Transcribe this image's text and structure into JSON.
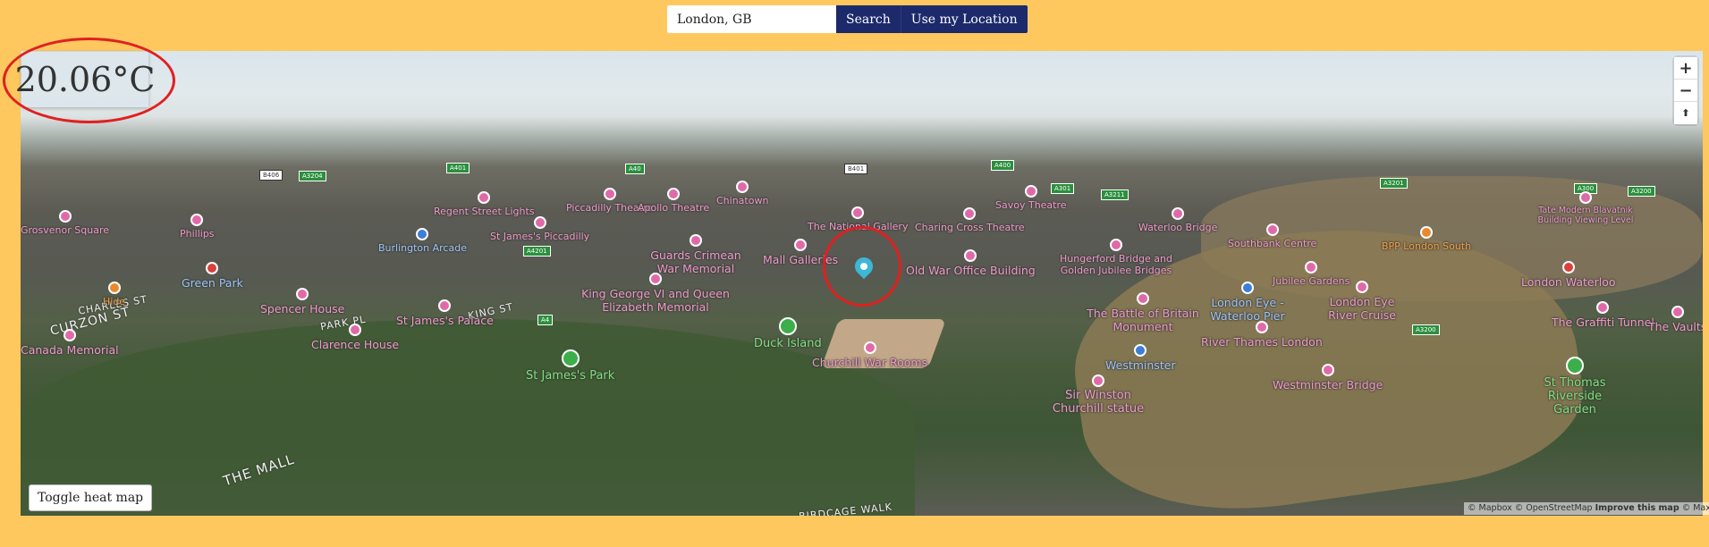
{
  "search": {
    "placeholder": "London, GB",
    "value": "London, GB",
    "search_label": "Search",
    "location_label": "Use my Location"
  },
  "weather": {
    "temperature": "20.06°C"
  },
  "map": {
    "zoom_in": "+",
    "zoom_out": "−",
    "compass": "⬆",
    "toggle_heat_label": "Toggle heat map",
    "attribution": {
      "mapbox": "© Mapbox",
      "osm": "© OpenStreetMap",
      "improve": "Improve this map",
      "maxar": "© Maxar"
    },
    "pois": [
      {
        "label": "Charing Cross Theatre",
        "kind": "pink"
      },
      {
        "label": "Old War Office Building",
        "kind": "pink"
      },
      {
        "label": "Mall Galleries",
        "kind": "pink"
      },
      {
        "label": "Guards Crimean War Memorial",
        "kind": "pink"
      },
      {
        "label": "King George VI and Queen Elizabeth Memorial",
        "kind": "pink"
      },
      {
        "label": "St James's Palace",
        "kind": "pink"
      },
      {
        "label": "Spencer House",
        "kind": "pink"
      },
      {
        "label": "Clarence House",
        "kind": "pink"
      },
      {
        "label": "Duck Island",
        "kind": "green"
      },
      {
        "label": "St James's Park",
        "kind": "green"
      },
      {
        "label": "Churchill War Rooms",
        "kind": "pink"
      },
      {
        "label": "Sir Winston Churchill statue",
        "kind": "pink"
      },
      {
        "label": "Westminster",
        "kind": "blue"
      },
      {
        "label": "Westminster Bridge",
        "kind": "pink"
      },
      {
        "label": "The Battle of Britain Monument",
        "kind": "pink"
      },
      {
        "label": "River Thames London",
        "kind": "pink"
      },
      {
        "label": "London Eye - Waterloo Pier",
        "kind": "blue"
      },
      {
        "label": "London Eye River Cruise",
        "kind": "pink"
      },
      {
        "label": "Jubilee Gardens",
        "kind": "pink"
      },
      {
        "label": "Hungerford Bridge and Golden Jubilee Bridges",
        "kind": "pink"
      },
      {
        "label": "Southbank Centre",
        "kind": "pink"
      },
      {
        "label": "Waterloo Bridge",
        "kind": "pink"
      },
      {
        "label": "BPP London South",
        "kind": "orange"
      },
      {
        "label": "London Waterloo",
        "kind": "blue"
      },
      {
        "label": "The Graffiti Tunnel",
        "kind": "pink"
      },
      {
        "label": "The Vaults",
        "kind": "pink"
      },
      {
        "label": "St Thomas Riverside Garden",
        "kind": "green"
      },
      {
        "label": "Green Park",
        "kind": "blue"
      },
      {
        "label": "Burlington Arcade",
        "kind": "blue"
      },
      {
        "label": "St James's Piccadilly",
        "kind": "pink"
      },
      {
        "label": "Phillips",
        "kind": "pink"
      },
      {
        "label": "Canada Memorial",
        "kind": "pink"
      },
      {
        "label": "Hide",
        "kind": "orange"
      },
      {
        "label": "Piccadilly Theatre",
        "kind": "pink"
      },
      {
        "label": "Apollo Theatre",
        "kind": "pink"
      },
      {
        "label": "Chinatown",
        "kind": "pink"
      },
      {
        "label": "Savoy Theatre",
        "kind": "pink"
      },
      {
        "label": "Regent Street Lights",
        "kind": "pink"
      },
      {
        "label": "Grosvenor Square",
        "kind": "pink"
      },
      {
        "label": "Tate Modern Blavatnik Building Viewing Level",
        "kind": "pink"
      },
      {
        "label": "The National Gallery",
        "kind": "pink"
      }
    ],
    "streets": [
      "THE MALL",
      "CURZON ST",
      "CHARLES ST",
      "KING ST",
      "PARK PL",
      "BIRDCAGE WALK"
    ],
    "roads": [
      "A4201",
      "A4",
      "A3200",
      "A3211",
      "A301",
      "A400",
      "A3204",
      "A40",
      "A3200",
      "A3201",
      "A300",
      "B406",
      "B401",
      "A401"
    ]
  }
}
